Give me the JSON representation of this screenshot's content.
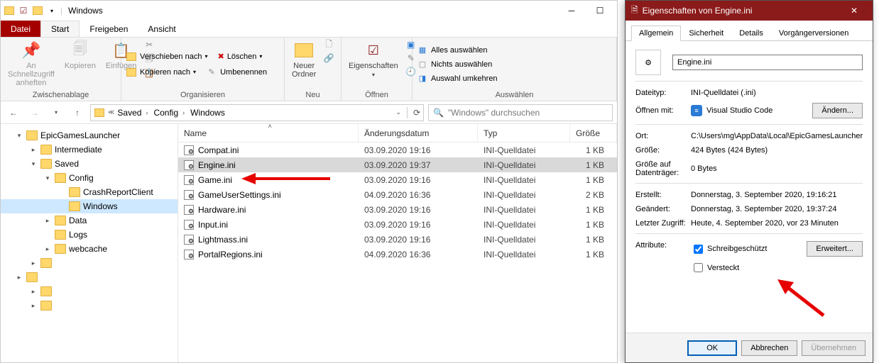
{
  "window_title": "Windows",
  "menubar": {
    "file": "Datei",
    "tabs": [
      "Start",
      "Freigeben",
      "Ansicht"
    ]
  },
  "ribbon": {
    "clipboard": {
      "label": "Zwischenablage",
      "pin": "An Schnellzugriff\nanheften",
      "copy": "Kopieren",
      "paste": "Einfügen"
    },
    "organize": {
      "label": "Organisieren",
      "move_to": "Verschieben nach",
      "copy_to": "Kopieren nach",
      "delete": "Löschen",
      "rename": "Umbenennen"
    },
    "new": {
      "label": "Neu",
      "new_folder": "Neuer\nOrdner"
    },
    "open": {
      "label": "Öffnen",
      "properties": "Eigenschaften"
    },
    "select": {
      "label": "Auswählen",
      "select_all": "Alles auswählen",
      "select_none": "Nichts auswählen",
      "invert": "Auswahl umkehren"
    }
  },
  "breadcrumb": [
    "Saved",
    "Config",
    "Windows"
  ],
  "search_placeholder": "\"Windows\" durchsuchen",
  "tree": [
    {
      "label": "EpicGamesLauncher",
      "indent": 0,
      "exp": "▾"
    },
    {
      "label": "Intermediate",
      "indent": 1,
      "exp": "▸"
    },
    {
      "label": "Saved",
      "indent": 1,
      "exp": "▾"
    },
    {
      "label": "Config",
      "indent": 2,
      "exp": "▾"
    },
    {
      "label": "CrashReportClient",
      "indent": 3,
      "exp": ""
    },
    {
      "label": "Windows",
      "indent": 3,
      "exp": "",
      "selected": true
    },
    {
      "label": "Data",
      "indent": 2,
      "exp": "▸"
    },
    {
      "label": "Logs",
      "indent": 2,
      "exp": ""
    },
    {
      "label": "webcache",
      "indent": 2,
      "exp": "▸"
    },
    {
      "label": "",
      "indent": 1,
      "exp": "▸",
      "blur": true
    },
    {
      "label": "",
      "indent": 0,
      "exp": "▸",
      "blur": true
    },
    {
      "label": "",
      "indent": 1,
      "exp": "▸",
      "blur": true
    },
    {
      "label": "",
      "indent": 1,
      "exp": "▸",
      "blur": true
    }
  ],
  "columns": {
    "name": "Name",
    "date": "Änderungsdatum",
    "type": "Typ",
    "size": "Größe"
  },
  "files": [
    {
      "name": "Compat.ini",
      "date": "03.09.2020 19:16",
      "type": "INI-Quelldatei",
      "size": "1 KB"
    },
    {
      "name": "Engine.ini",
      "date": "03.09.2020 19:37",
      "type": "INI-Quelldatei",
      "size": "1 KB",
      "selected": true
    },
    {
      "name": "Game.ini",
      "date": "03.09.2020 19:16",
      "type": "INI-Quelldatei",
      "size": "1 KB"
    },
    {
      "name": "GameUserSettings.ini",
      "date": "04.09.2020 16:36",
      "type": "INI-Quelldatei",
      "size": "2 KB"
    },
    {
      "name": "Hardware.ini",
      "date": "03.09.2020 19:16",
      "type": "INI-Quelldatei",
      "size": "1 KB"
    },
    {
      "name": "Input.ini",
      "date": "03.09.2020 19:16",
      "type": "INI-Quelldatei",
      "size": "1 KB"
    },
    {
      "name": "Lightmass.ini",
      "date": "03.09.2020 19:16",
      "type": "INI-Quelldatei",
      "size": "1 KB"
    },
    {
      "name": "PortalRegions.ini",
      "date": "04.09.2020 16:36",
      "type": "INI-Quelldatei",
      "size": "1 KB"
    }
  ],
  "properties": {
    "title": "Eigenschaften von Engine.ini",
    "tabs": [
      "Allgemein",
      "Sicherheit",
      "Details",
      "Vorgängerversionen"
    ],
    "filename": "Engine.ini",
    "rows": {
      "filetype_k": "Dateityp:",
      "filetype_v": "INI-Quelldatei (.ini)",
      "openwith_k": "Öffnen mit:",
      "openwith_v": "Visual Studio Code",
      "change_btn": "Ändern...",
      "location_k": "Ort:",
      "location_v": "C:\\Users\\mg\\AppData\\Local\\EpicGamesLauncher\\",
      "size_k": "Größe:",
      "size_v": "424 Bytes (424 Bytes)",
      "sizeondisk_k": "Größe auf Datenträger:",
      "sizeondisk_v": "0 Bytes",
      "created_k": "Erstellt:",
      "created_v": "Donnerstag, 3. September 2020, 19:16:21",
      "modified_k": "Geändert:",
      "modified_v": "Donnerstag, 3. September 2020, 19:37:24",
      "accessed_k": "Letzter Zugriff:",
      "accessed_v": "Heute, 4. September 2020, vor 23 Minuten",
      "attrs_k": "Attribute:",
      "readonly": "Schreibgeschützt",
      "hidden": "Versteckt",
      "advanced_btn": "Erweitert..."
    },
    "buttons": {
      "ok": "OK",
      "cancel": "Abbrechen",
      "apply": "Übernehmen"
    }
  }
}
